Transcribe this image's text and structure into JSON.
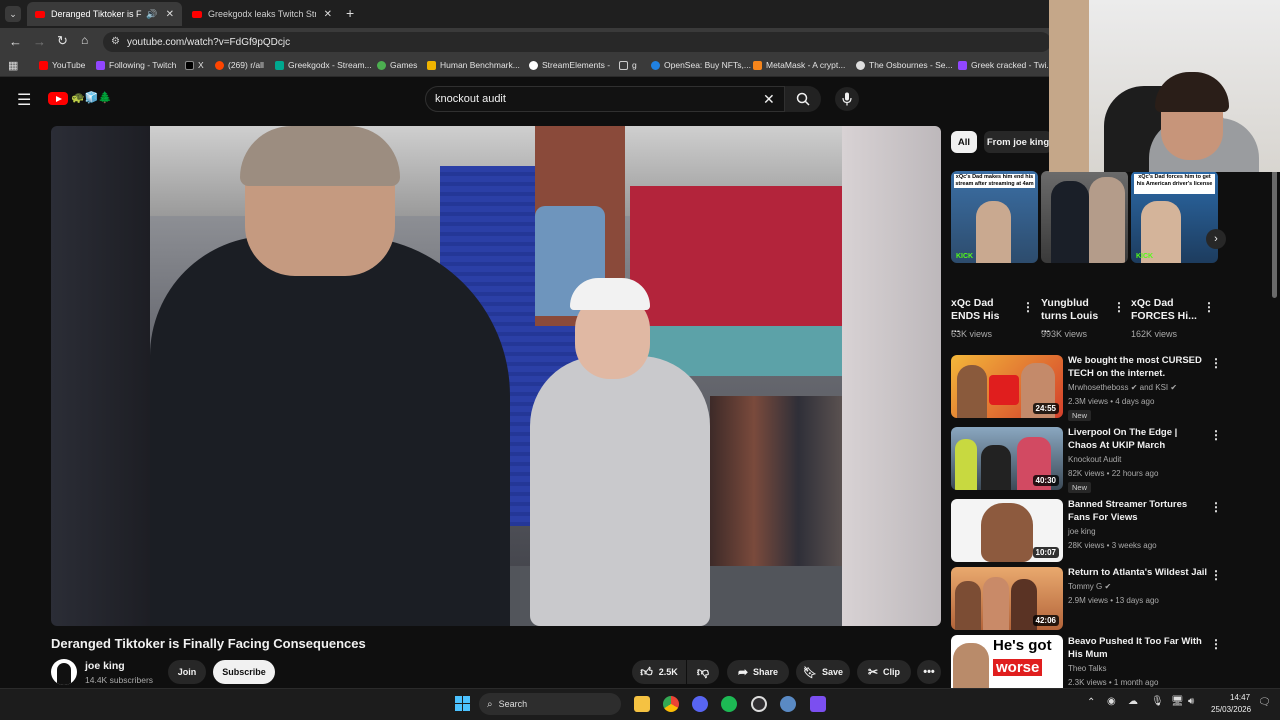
{
  "tabs": [
    {
      "title": "Deranged Tiktoker is Finally Facing Consequences",
      "active": true
    },
    {
      "title": "Greekgodx leaks Twitch Streamers",
      "active": false
    }
  ],
  "address": {
    "url": "youtube.com/watch?v=FdGf9pQDcjc"
  },
  "bookmarks": [
    "YouTube",
    "Following - Twitch",
    "X",
    "(269) r/all",
    "Greekgodx - Stream...",
    "Games",
    "Human Benchmark...",
    "StreamElements -",
    "g",
    "OpenSea: Buy NFTs,...",
    "MetaMask - A crypt...",
    "The Osbournes - Se...",
    "Greek cracked - Twi..."
  ],
  "search": {
    "query": "knockout audit"
  },
  "video": {
    "title": "Deranged Tiktoker is Finally Facing Consequences",
    "channel": "joe king",
    "subscribers": "14.4K subscribers",
    "join_label": "Join",
    "subscribe_label": "Subscribe",
    "likes": "2.5K",
    "share_label": "Share",
    "save_label": "Save",
    "clip_label": "Clip"
  },
  "chips": [
    "All",
    "From joe king"
  ],
  "shelf": [
    {
      "title": "xQc Dad ENDS His ...",
      "views": "63K views",
      "caption": "xQc's Dad makes him end his stream after streaming at 4am"
    },
    {
      "title": "Yungblud turns Louis ...",
      "views": "993K views",
      "caption": ""
    },
    {
      "title": "xQc Dad FORCES Hi...",
      "views": "162K views",
      "caption": "xQc's Dad forces him to get his American driver's license"
    }
  ],
  "recommendations": [
    {
      "title": "We bought the most CURSED TECH on the internet.",
      "channel": "Mrwhosetheboss",
      "channel_extra": "and KSI",
      "meta": "2.3M views • 4 days ago",
      "duration": "24:55",
      "badge": "New"
    },
    {
      "title": "Liverpool On The Edge | Chaos At UKIP March",
      "channel": "Knockout Audit",
      "channel_extra": "",
      "meta": "82K views • 22 hours ago",
      "duration": "40:30",
      "badge": "New"
    },
    {
      "title": "Banned Streamer Tortures Fans For Views",
      "channel": "joe king",
      "channel_extra": "",
      "meta": "28K views • 3 weeks ago",
      "duration": "10:07",
      "badge": ""
    },
    {
      "title": "Return to Atlanta's Wildest Jail",
      "channel": "Tommy G",
      "channel_extra": "",
      "meta": "2.9M views • 13 days ago",
      "duration": "42:06",
      "badge": ""
    },
    {
      "title": "Beavo Pushed It Too Far With His Mum",
      "channel": "Theo Talks",
      "channel_extra": "",
      "meta": "2.3K views • 1 month ago",
      "duration": "",
      "badge": "",
      "thumb_text_1": "He's got",
      "thumb_text_2": "worse"
    }
  ],
  "taskbar": {
    "search_label": "Search",
    "time": "14:47",
    "date": "25/03/2026"
  },
  "colors": {
    "bg": "#0f0f0f",
    "yt_red": "#ff0000",
    "subscribe_bg": "#f1f1f1"
  }
}
